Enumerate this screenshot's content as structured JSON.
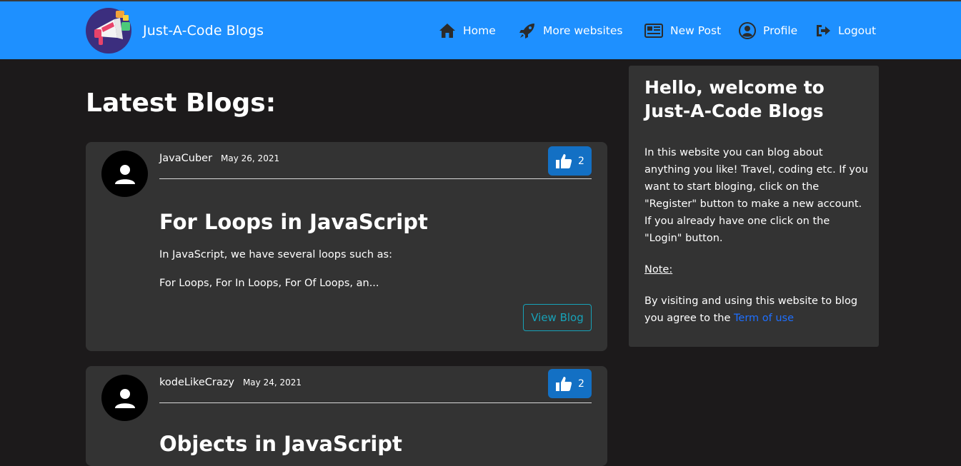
{
  "navbar": {
    "brand": "Just-A-Code Blogs",
    "items": [
      {
        "label": "Home",
        "icon": "home-icon"
      },
      {
        "label": "More websites",
        "icon": "rocket-icon"
      },
      {
        "label": "New Post",
        "icon": "newspaper-icon"
      },
      {
        "label": "Profile",
        "icon": "user-circle-icon"
      },
      {
        "label": "Logout",
        "icon": "logout-icon"
      }
    ]
  },
  "main": {
    "heading": "Latest Blogs:",
    "posts": [
      {
        "author": "JavaCuber",
        "date": "May 26, 2021",
        "likes": "2",
        "title": "For Loops in JavaScript",
        "excerpt_line1": "In JavaScript, we have several loops such as:",
        "excerpt_line2": "For Loops, For In Loops, For Of Loops, an...",
        "view_label": "View Blog"
      },
      {
        "author": "kodeLikeCrazy",
        "date": "May 24, 2021",
        "likes": "2",
        "title": "Objects in JavaScript"
      }
    ]
  },
  "sidebar": {
    "title": "Hello, welcome to Just-A-Code Blogs",
    "body": "In this website you can blog about anything you like! Travel, coding etc. If you want to start bloging, click on the \"Register\" button to make a new account. If you already have one click on the \"Login\" button.",
    "note_label": "Note:",
    "agree_text": "By visiting and using this website to blog you agree to the ",
    "terms_link": "Term of use"
  },
  "colors": {
    "navbar": "#1e90ff",
    "background": "#1c1a1b",
    "card": "#333333",
    "like_button": "#1370c4",
    "view_button": "#17a2b8"
  }
}
